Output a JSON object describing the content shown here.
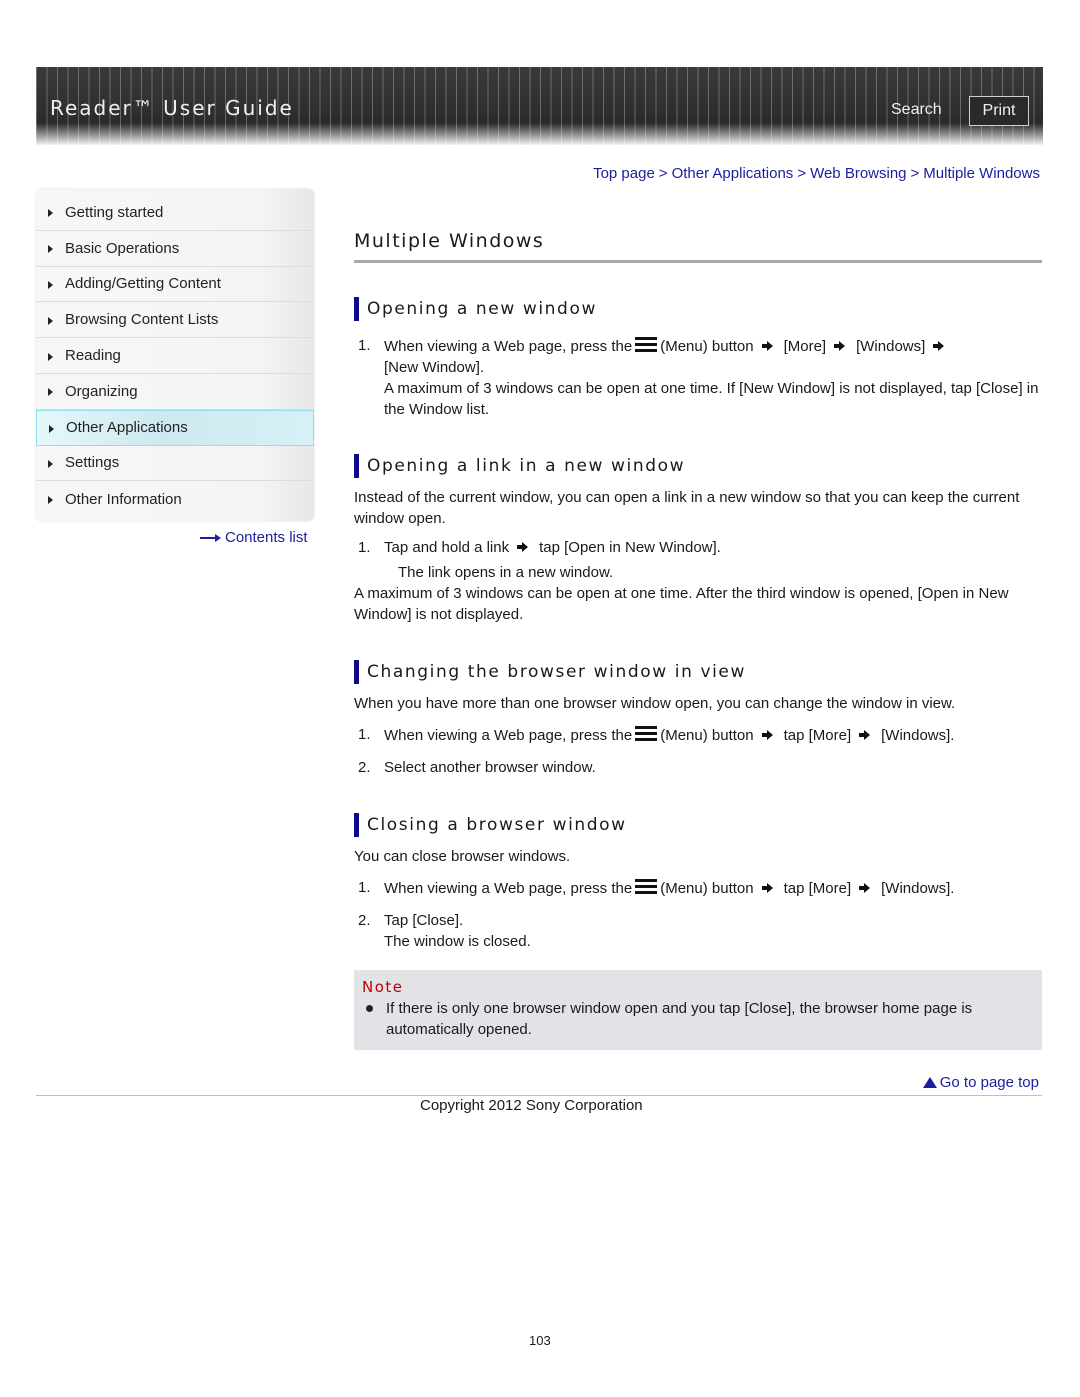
{
  "header": {
    "title": "Reader™ User Guide",
    "search_label": "Search",
    "print_label": "Print"
  },
  "breadcrumb": [
    {
      "label": "Top page"
    },
    {
      "label": "Other Applications"
    },
    {
      "label": "Web Browsing"
    },
    {
      "label": "Multiple Windows"
    }
  ],
  "breadcrumb_separator": ">",
  "sidebar": {
    "items": [
      {
        "label": "Getting started",
        "active": false
      },
      {
        "label": "Basic Operations",
        "active": false
      },
      {
        "label": "Adding/Getting Content",
        "active": false
      },
      {
        "label": "Browsing Content Lists",
        "active": false
      },
      {
        "label": "Reading",
        "active": false
      },
      {
        "label": "Organizing",
        "active": false
      },
      {
        "label": "Other Applications",
        "active": true
      },
      {
        "label": "Settings",
        "active": false
      },
      {
        "label": "Other Information",
        "active": false
      }
    ],
    "contents_link": "Contents list"
  },
  "main": {
    "title": "Multiple Windows",
    "sections": [
      {
        "heading": "Opening a new window",
        "step1": {
          "num": "1.",
          "pre": "When viewing a Web page, press the",
          "menu": "(Menu) button",
          "a": "[More]",
          "b": "[Windows]",
          "c": "[New Window].",
          "detail": "A maximum of 3 windows can be open at one time. If [New Window] is not displayed, tap [Close] in the Window list."
        }
      },
      {
        "heading": "Opening a link in a new window",
        "intro": "Instead of the current window, you can open a link in a new window so that you can keep the current window open.",
        "step1": {
          "num": "1.",
          "pre": "Tap and hold a link",
          "a": "tap [Open in New Window].",
          "detail": "The link opens in a new window."
        },
        "outro": "A maximum of 3 windows can be open at one time. After the third window is opened, [Open in New Window] is not displayed."
      },
      {
        "heading": "Changing the browser window in view",
        "intro": "When you have more than one browser window open, you can change the window in view.",
        "step1": {
          "num": "1.",
          "pre": "When viewing a Web page, press the",
          "menu": "(Menu) button",
          "a": "tap [More]",
          "b": "[Windows]."
        },
        "step2": {
          "num": "2.",
          "text": "Select another browser window."
        }
      },
      {
        "heading": "Closing a browser window",
        "intro": "You can close browser windows.",
        "step1": {
          "num": "1.",
          "pre": "When viewing a Web page, press the",
          "menu": "(Menu) button",
          "a": "tap [More]",
          "b": "[Windows]."
        },
        "step2": {
          "num": "2.",
          "text": "Tap [Close].",
          "detail": "The window is closed."
        }
      }
    ],
    "note": {
      "title": "Note",
      "items": [
        "If there is only one browser window open and you tap [Close], the browser home page is automatically opened."
      ]
    }
  },
  "footer": {
    "go_to_top": "Go to page top",
    "copyright": "Copyright 2012 Sony Corporation",
    "page_number": "103"
  },
  "colors": {
    "link": "#1d1d9e",
    "section_bar": "#0a0a8a",
    "note_title": "#c00000",
    "note_bg": "#e1e3e6",
    "active_item_border": "#8fe0ef"
  }
}
